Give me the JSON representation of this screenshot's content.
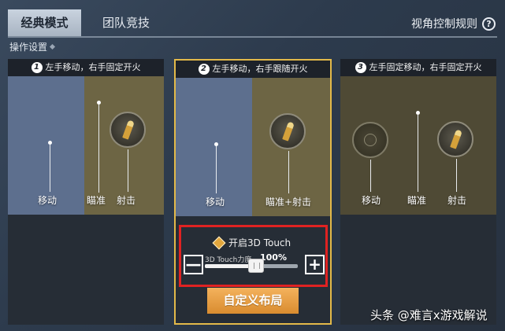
{
  "tabs": [
    {
      "label": "经典模式",
      "active": true
    },
    {
      "label": "团队竞技",
      "active": false
    }
  ],
  "rules_label": "视角控制规则",
  "help_icon_text": "?",
  "section_label": "操作设置",
  "cards": [
    {
      "number": "1",
      "title": "左手移动，右手固定开火",
      "zones": [
        "移动",
        "瞄准",
        "射击"
      ]
    },
    {
      "number": "2",
      "title": "左手移动，右手跟随开火",
      "zones": [
        "移动",
        "瞄准+射击"
      ]
    },
    {
      "number": "3",
      "title": "左手固定移动，右手固定开火",
      "zones": [
        "移动",
        "瞄准",
        "射击"
      ]
    }
  ],
  "touch": {
    "title": "开启3D Touch",
    "sub_label": "3D Touch力度",
    "percent": "100%",
    "slider_value": 0.55,
    "minus": "—",
    "plus": "+"
  },
  "custom_button": "自定义布局",
  "watermark": "头条 @难言x游戏解说",
  "colors": {
    "selected_border": "#e3b949",
    "highlight": "#e02222",
    "button": "#e8a040"
  }
}
